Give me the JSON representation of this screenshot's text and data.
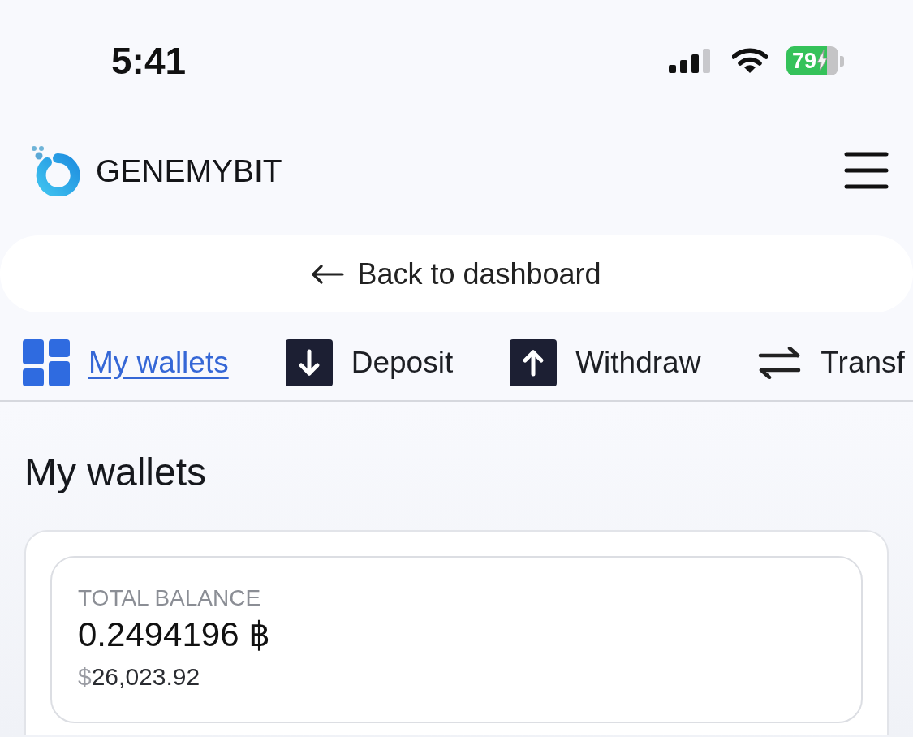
{
  "status_bar": {
    "time": "5:41",
    "battery": "79",
    "charging": true
  },
  "header": {
    "brand": "GENEMYBIT"
  },
  "back_link": {
    "label": "Back to dashboard"
  },
  "tabs": [
    {
      "label": "My wallets",
      "selected": true
    },
    {
      "label": "Deposit",
      "selected": false
    },
    {
      "label": "Withdraw",
      "selected": false
    },
    {
      "label": "Transf",
      "selected": false
    }
  ],
  "page_title": "My wallets",
  "balance_card": {
    "label": "TOTAL BALANCE",
    "amount": "0.2494196 ฿",
    "fiat_symbol": "$",
    "fiat_amount": "26,023.92"
  }
}
